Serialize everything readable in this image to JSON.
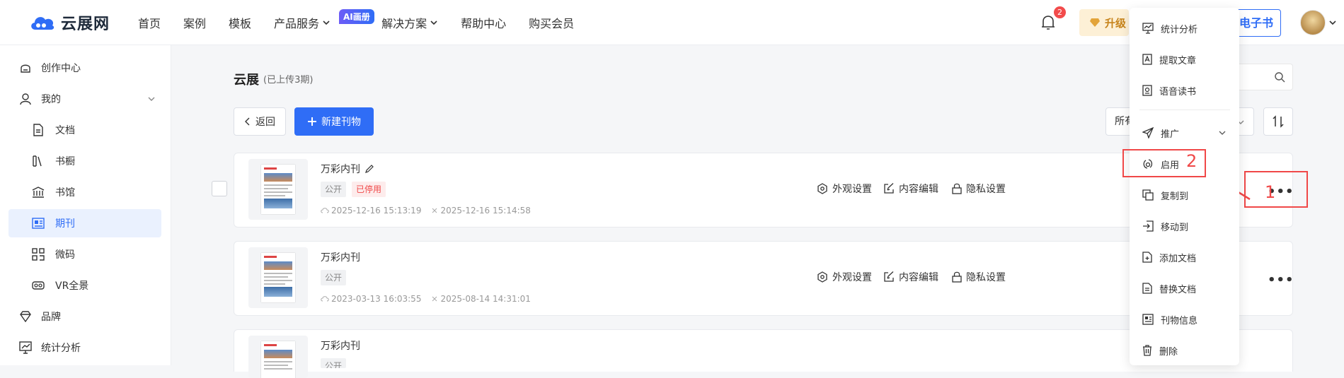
{
  "brand": {
    "name": "云展网"
  },
  "nav": {
    "items": [
      "首页",
      "案例",
      "模板",
      "产品服务",
      "解决方案",
      "帮助中心",
      "购买会员"
    ],
    "ai_badge": "AI画册"
  },
  "header": {
    "notification_count": "2",
    "upgrade_label": "升级",
    "ebook_label": "电子书"
  },
  "sidebar": {
    "items": [
      {
        "label": "创作中心",
        "icon": "home-icon"
      },
      {
        "label": "我的",
        "icon": "user-icon"
      },
      {
        "label": "文档",
        "icon": "document-icon"
      },
      {
        "label": "书橱",
        "icon": "bookshelf-icon"
      },
      {
        "label": "书馆",
        "icon": "library-icon"
      },
      {
        "label": "期刊",
        "icon": "journal-icon"
      },
      {
        "label": "微码",
        "icon": "qrcode-icon"
      },
      {
        "label": "VR全景",
        "icon": "vr-icon"
      },
      {
        "label": "品牌",
        "icon": "brand-icon"
      },
      {
        "label": "统计分析",
        "icon": "chart-icon"
      }
    ]
  },
  "page": {
    "title": "云展",
    "subtitle": "(已上传3期)",
    "back_label": "返回",
    "new_label": "新建刊物",
    "filter_label": "所有"
  },
  "rows": [
    {
      "name": "万彩内刊",
      "tag_public": "公开",
      "tag_status": "已停用",
      "created": "2025-12-16 15:13:19",
      "updated": "2025-12-16 15:14:58"
    },
    {
      "name": "万彩内刊",
      "tag_public": "公开",
      "tag_status": "",
      "created": "2023-03-13 16:03:55",
      "updated": "2025-08-14 14:31:01"
    },
    {
      "name": "万彩内刊",
      "tag_public": "公开",
      "tag_status": "",
      "created": "",
      "updated": ""
    }
  ],
  "row_actions": {
    "appearance": "外观设置",
    "edit": "内容编辑",
    "privacy": "隐私设置",
    "more": "•••"
  },
  "menu": {
    "items": [
      "统计分析",
      "提取文章",
      "语音读书",
      "推广",
      "启用",
      "复制到",
      "移动到",
      "添加文档",
      "替换文档",
      "刊物信息",
      "删除"
    ]
  },
  "annotations": {
    "label_1": "1",
    "label_2": "2"
  },
  "colors": {
    "primary": "#2f6df6",
    "danger": "#f04848",
    "active_bg": "#eaf1fe"
  }
}
